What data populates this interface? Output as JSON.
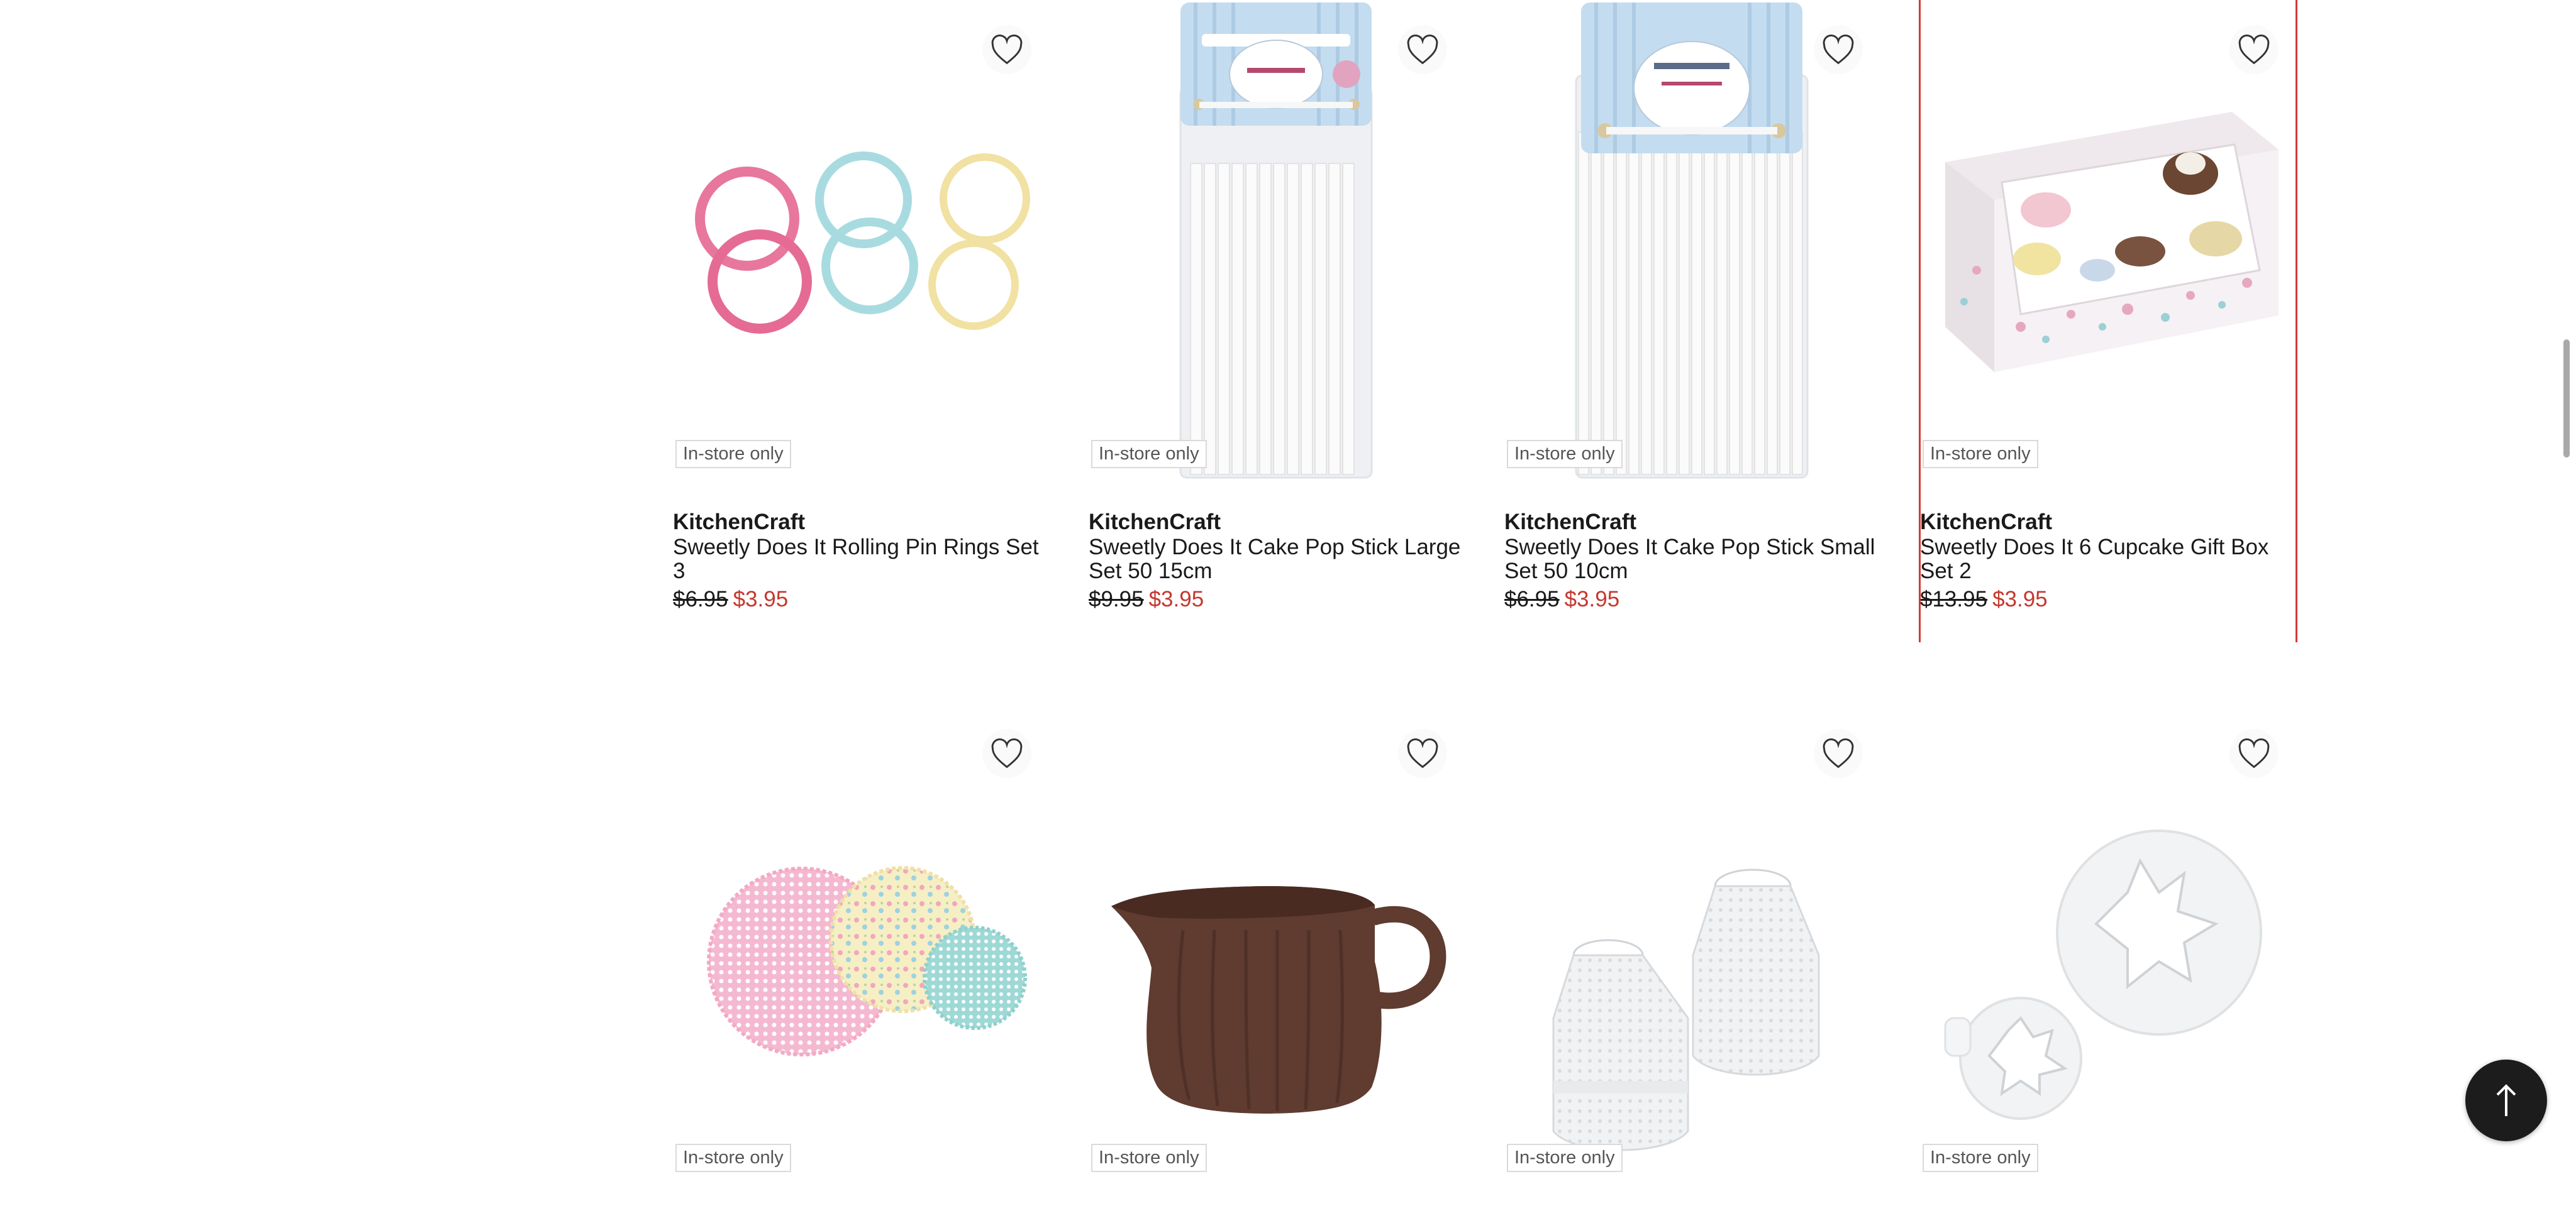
{
  "colors": {
    "sale_price": "#c4382e",
    "selection_outline": "#d63a35",
    "badge_border": "#dadada",
    "scroll_top_button": "#1c1c1c"
  },
  "icons": {
    "wishlist": "heart-outline-icon",
    "scroll_top": "arrow-up-icon"
  },
  "products": [
    {
      "brand": "KitchenCraft",
      "title": "Sweetly Does It Rolling Pin Rings Set 3",
      "old_price": "$6.95",
      "price": "$3.95",
      "badge": "In-store only",
      "image": "pin-rings-image"
    },
    {
      "brand": "KitchenCraft",
      "title": "Sweetly Does It Cake Pop Stick Large Set 50 15cm",
      "old_price": "$9.95",
      "price": "$3.95",
      "badge": "In-store only",
      "image": "cake-pop-sticks-image"
    },
    {
      "brand": "KitchenCraft",
      "title": "Sweetly Does It Cake Pop Stick Small Set 50 10cm",
      "old_price": "$6.95",
      "price": "$3.95",
      "badge": "In-store only",
      "image": "cake-pop-sticks-small-image"
    },
    {
      "brand": "KitchenCraft",
      "title": "Sweetly Does It 6 Cupcake Gift Box Set 2",
      "old_price": "$13.95",
      "price": "$3.95",
      "badge": "In-store only",
      "image": "cupcake-gift-box-image"
    },
    {
      "badge": "In-store only",
      "image": "cake-doilies-image"
    },
    {
      "badge": "In-store only",
      "image": "chocolate-jug-image"
    },
    {
      "badge": "In-store only",
      "image": "piping-couplers-image"
    },
    {
      "badge": "In-store only",
      "image": "holly-plunger-cutters-image"
    }
  ]
}
